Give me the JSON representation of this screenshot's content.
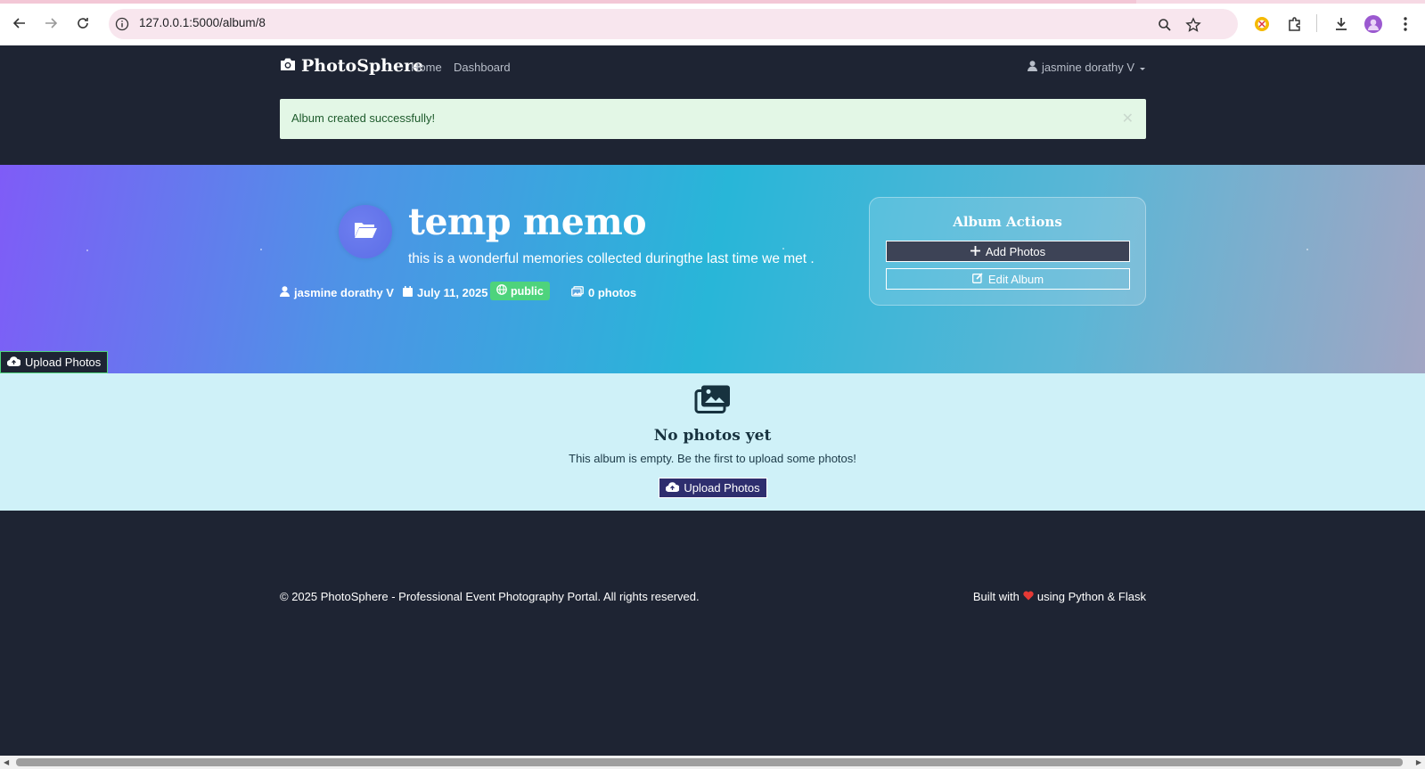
{
  "browser": {
    "url": "127.0.0.1:5000/album/8",
    "icons": [
      "back-icon",
      "forward-icon",
      "reload-icon",
      "info-icon",
      "zoom-icon",
      "star-icon",
      "extension-icon",
      "puzzle-icon",
      "download-icon",
      "profile-icon",
      "more-icon"
    ]
  },
  "navbar": {
    "brand": "PhotoSphere",
    "links": [
      "Home",
      "Dashboard"
    ],
    "user": "jasmine dorathy V"
  },
  "alert": {
    "message": "Album created successfully!"
  },
  "album": {
    "title": "temp memo",
    "description": "this is a wonderful memories collected duringthe last time we met .",
    "owner": "jasmine dorathy V",
    "date": "July 11, 2025",
    "visibility": "public",
    "photo_count": "0 photos"
  },
  "actions": {
    "title": "Album Actions",
    "add_photos": "Add Photos",
    "edit_album": "Edit Album"
  },
  "upload_top_label": "Upload Photos",
  "empty_state": {
    "heading": "No photos yet",
    "text": "This album is empty. Be the first to upload some photos!",
    "button": "Upload Photos"
  },
  "footer": {
    "left": "© 2025 PhotoSphere - Professional Event Photography Portal. All rights reserved.",
    "right_prefix": "Built with",
    "right_suffix": "using Python & Flask"
  },
  "colors": {
    "page_bg": "#1e2433",
    "success_badge": "#4ed37c",
    "alert_bg": "#e3f7e6",
    "empty_bg": "#cff1f8",
    "heart": "#e53935"
  }
}
